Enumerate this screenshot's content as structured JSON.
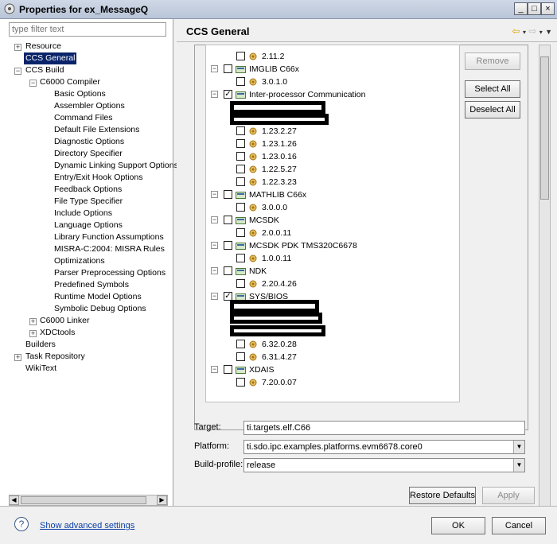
{
  "window": {
    "title": "Properties for ex_MessageQ",
    "controls": [
      "_",
      "□",
      "×"
    ]
  },
  "sidebar": {
    "filter_placeholder": "type filter text",
    "items": [
      {
        "label": "Resource",
        "expander": "+"
      },
      {
        "label": "CCS General",
        "selected": true
      },
      {
        "label": "CCS Build",
        "expander": "−"
      },
      {
        "label": "C6000 Compiler",
        "expander": "−"
      },
      {
        "label": "Basic Options"
      },
      {
        "label": "Assembler Options"
      },
      {
        "label": "Command Files"
      },
      {
        "label": "Default File Extensions"
      },
      {
        "label": "Diagnostic Options"
      },
      {
        "label": "Directory Specifier"
      },
      {
        "label": "Dynamic Linking Support Options"
      },
      {
        "label": "Entry/Exit Hook Options"
      },
      {
        "label": "Feedback Options"
      },
      {
        "label": "File Type Specifier"
      },
      {
        "label": "Include Options"
      },
      {
        "label": "Language Options"
      },
      {
        "label": "Library Function Assumptions"
      },
      {
        "label": "MISRA-C:2004: MISRA Rules"
      },
      {
        "label": "Optimizations"
      },
      {
        "label": "Parser Preprocessing Options"
      },
      {
        "label": "Predefined Symbols"
      },
      {
        "label": "Runtime Model Options"
      },
      {
        "label": "Symbolic Debug Options"
      },
      {
        "label": "C6000 Linker",
        "expander": "+"
      },
      {
        "label": "XDCtools",
        "expander": "+"
      },
      {
        "label": "Builders"
      },
      {
        "label": "Task Repository",
        "expander": "+"
      },
      {
        "label": "WikiText"
      }
    ]
  },
  "main": {
    "title": "CCS General",
    "packages": [
      {
        "label": "2.11.2",
        "kind": "version"
      },
      {
        "label": "IMGLIB C66x",
        "kind": "product",
        "expander": "−"
      },
      {
        "label": "3.0.1.0",
        "kind": "version"
      },
      {
        "label": "Inter-processor Communication",
        "kind": "product",
        "expander": "−",
        "checked": true
      },
      {
        "label": "1.23.2.27",
        "kind": "version"
      },
      {
        "label": "1.23.1.26",
        "kind": "version"
      },
      {
        "label": "1.23.0.16",
        "kind": "version"
      },
      {
        "label": "1.22.5.27",
        "kind": "version"
      },
      {
        "label": "1.22.3.23",
        "kind": "version"
      },
      {
        "label": "MATHLIB C66x",
        "kind": "product",
        "expander": "−"
      },
      {
        "label": "3.0.0.0",
        "kind": "version"
      },
      {
        "label": "MCSDK",
        "kind": "product",
        "expander": "−"
      },
      {
        "label": "2.0.0.11",
        "kind": "version"
      },
      {
        "label": "MCSDK PDK TMS320C6678",
        "kind": "product",
        "expander": "−"
      },
      {
        "label": "1.0.0.11",
        "kind": "version"
      },
      {
        "label": "NDK",
        "kind": "product",
        "expander": "−"
      },
      {
        "label": "2.20.4.26",
        "kind": "version"
      },
      {
        "label": "SYS/BIOS",
        "kind": "product",
        "expander": "−",
        "checked": true
      },
      {
        "label": "6.32.0.28",
        "kind": "version"
      },
      {
        "label": "6.31.4.27",
        "kind": "version"
      },
      {
        "label": "XDAIS",
        "kind": "product",
        "expander": "−"
      },
      {
        "label": "7.20.0.07",
        "kind": "version"
      }
    ],
    "buttons": {
      "remove": "Remove",
      "select_all": "Select All",
      "deselect_all": "Deselect All"
    },
    "fields": {
      "target_label": "Target:",
      "target_value": "ti.targets.elf.C66",
      "platform_label": "Platform:",
      "platform_value": "ti.sdo.ipc.examples.platforms.evm6678.core0",
      "buildprofile_label": "Build-profile:",
      "buildprofile_value": "release"
    },
    "restore_defaults": "Restore Defaults",
    "apply": "Apply"
  },
  "footer": {
    "help": "?",
    "show_advanced": "Show advanced settings",
    "ok": "OK",
    "cancel": "Cancel"
  }
}
